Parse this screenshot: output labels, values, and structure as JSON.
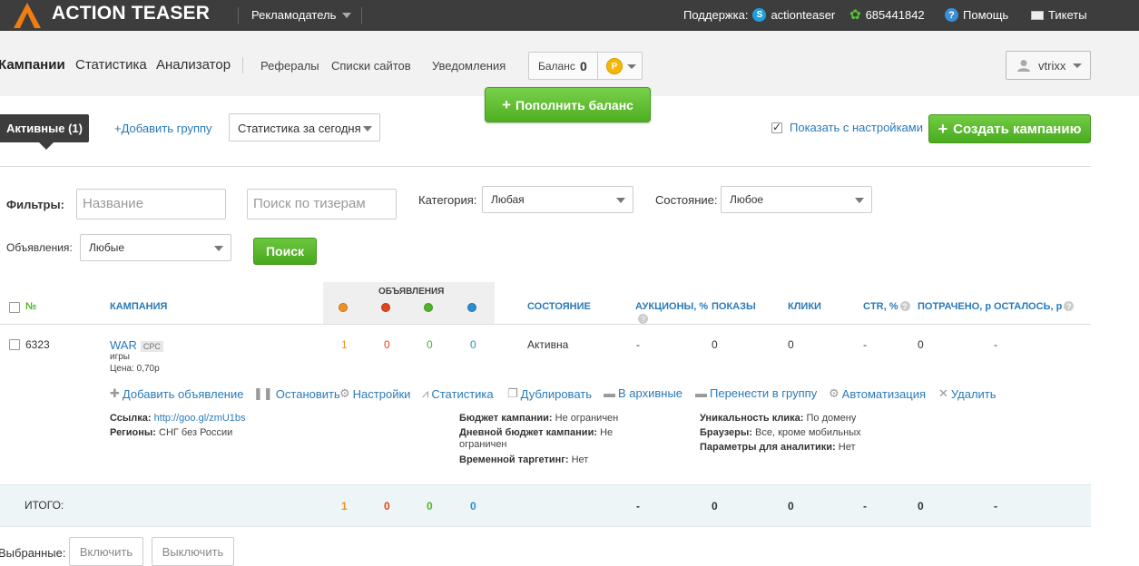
{
  "topbar": {
    "brand": "ACTION TEASER",
    "role": "Рекламодатель",
    "support_label": "Поддержка:",
    "skype": "actionteaser",
    "icq": "685441842",
    "help": "Помощь",
    "tickets": "Тикеты"
  },
  "nav": {
    "main": [
      "Кампании",
      "Статистика",
      "Анализатор"
    ],
    "sub": [
      "Рефералы",
      "Списки сайтов",
      "Уведомления"
    ],
    "balance_label": "Баланс",
    "balance_value": "0",
    "coin_symbol": "Р",
    "username": "vtrixx"
  },
  "topup_label": "Пополнить баланс",
  "toolbar": {
    "active_tab": "Активные (1)",
    "add_group": "+Добавить группу",
    "stats_period": "Статистика за сегодня",
    "show_settings": "Показать с настройками",
    "show_settings_checked": true,
    "create_campaign": "Создать кампанию"
  },
  "filters": {
    "label": "Фильтры:",
    "name_placeholder": "Название",
    "teaser_placeholder": "Поиск по тизерам",
    "category_label": "Категория:",
    "category_value": "Любая",
    "state_label": "Состояние:",
    "state_value": "Любое",
    "ads_label": "Объявления:",
    "ads_value": "Любые",
    "search_button": "Поиск"
  },
  "table": {
    "headers": {
      "num": "№",
      "campaign": "КАМПАНИЯ",
      "ads": "ОБЪЯВЛЕНИЯ",
      "state": "СОСТОЯНИЕ",
      "auctions": "АУКЦИОНЫ, %",
      "shows": "ПОКАЗЫ",
      "clicks": "КЛИКИ",
      "ctr": "CTR, %",
      "spent": "ПОТРАЧЕНО, р",
      "left": "ОСТАЛОСЬ, р"
    },
    "ad_dot_colors": [
      "#f0901e",
      "#e0441c",
      "#4fb52a",
      "#2a8fd0"
    ],
    "row": {
      "id": "6323",
      "name": "WAR",
      "type": "CPC",
      "category": "игры",
      "price": "Цена: 0,70р",
      "ads_counts": [
        "1",
        "0",
        "0",
        "0"
      ],
      "state": "Активна",
      "auctions": "-",
      "shows": "0",
      "clicks": "0",
      "ctr": "-",
      "spent": "0",
      "left": "-"
    },
    "actions": [
      "Добавить объявление",
      "Остановить",
      "Настройки",
      "Статистика",
      "Дублировать",
      "В архивные",
      "Перенести в группу",
      "Автоматизация",
      "Удалить"
    ],
    "info": {
      "link_label": "Ссылка:",
      "link_value": "http://goo.gl/zmU1bs",
      "regions_label": "Регионы:",
      "regions_value": "СНГ без России",
      "budget_label": "Бюджет кампании:",
      "budget_value": "Не ограничен",
      "daily_label": "Дневной бюджет кампании:",
      "daily_value": "Не ограничен",
      "time_label": "Временной таргетинг:",
      "time_value": "Нет",
      "unique_label": "Уникальность клика:",
      "unique_value": "По домену",
      "browsers_label": "Браузеры:",
      "browsers_value": "Все, кроме мобильных",
      "analytics_label": "Параметры для аналитики:",
      "analytics_value": "Нет"
    },
    "total": {
      "label": "ИТОГО:",
      "ads_counts": [
        "1",
        "0",
        "0",
        "0"
      ],
      "auctions": "-",
      "shows": "0",
      "clicks": "0",
      "ctr": "-",
      "spent": "0",
      "left": "-"
    }
  },
  "footer": {
    "selected_label": "Выбранные:",
    "enable": "Включить",
    "disable": "Выключить"
  }
}
